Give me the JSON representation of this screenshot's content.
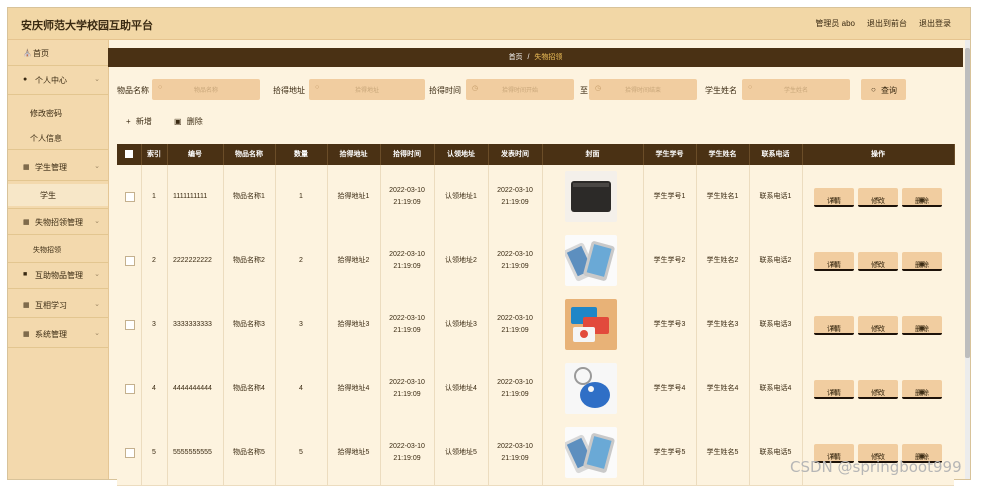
{
  "app": {
    "title": "安庆师范大学校园互助平台"
  },
  "topbar": {
    "user_label": "管理员 abo",
    "back_to_front": "退出到前台",
    "logout": "退出登录"
  },
  "sidebar": {
    "home": "首页",
    "personal_center": "个人中心",
    "change_password": "修改密码",
    "personal_info": "个人信息",
    "student_mgmt": "学生管理",
    "student": "学生",
    "lost_found_mgmt": "失物招领管理",
    "lost_found": "失物招领",
    "mutual_goods_mgmt": "互助物品管理",
    "mutual_learning": "互相学习",
    "system_mgmt": "系统管理"
  },
  "breadcrumb": {
    "home": "首页",
    "sep": "/",
    "current": "失物招领"
  },
  "search": {
    "item_name_label": "物品名称",
    "item_name_placeholder": "物品名称",
    "pickup_place_label": "拾得地址",
    "pickup_place_placeholder": "拾得地址",
    "pickup_time_label": "拾得时间",
    "pickup_time_start_placeholder": "拾得时间开始",
    "to_label": "至",
    "pickup_time_end_placeholder": "拾得时间结束",
    "student_name_label": "学生姓名",
    "student_name_placeholder": "学生姓名",
    "search_button": "查询"
  },
  "actions": {
    "add": "新增",
    "delete": "删除"
  },
  "table": {
    "headers": [
      "索引",
      "编号",
      "物品名称",
      "数量",
      "拾得地址",
      "拾得时间",
      "认领地址",
      "发表时间",
      "封面",
      "学生学号",
      "学生姓名",
      "联系电话",
      "操作"
    ],
    "op_labels": {
      "detail": "详情",
      "edit": "修改",
      "delete": "删除"
    },
    "rows": [
      {
        "index": "1",
        "code": "1111111111",
        "name": "物品名称1",
        "qty": "1",
        "pickup_place": "拾得地址1",
        "pickup_date": "2022-03-10",
        "pickup_time": "21:19:09",
        "claim_place": "认领地址1",
        "post_date": "2022-03-10",
        "post_time": "21:19:09",
        "cover": "wallet",
        "student_no": "学生学号1",
        "student_name": "学生姓名1",
        "phone": "联系电话1"
      },
      {
        "index": "2",
        "code": "2222222222",
        "name": "物品名称2",
        "qty": "2",
        "pickup_place": "拾得地址2",
        "pickup_date": "2022-03-10",
        "pickup_time": "21:19:09",
        "claim_place": "认领地址2",
        "post_date": "2022-03-10",
        "post_time": "21:19:09",
        "cover": "phone",
        "student_no": "学生学号2",
        "student_name": "学生姓名2",
        "phone": "联系电话2"
      },
      {
        "index": "3",
        "code": "3333333333",
        "name": "物品名称3",
        "qty": "3",
        "pickup_place": "拾得地址3",
        "pickup_date": "2022-03-10",
        "pickup_time": "21:19:09",
        "claim_place": "认领地址3",
        "post_date": "2022-03-10",
        "post_time": "21:19:09",
        "cover": "cards",
        "student_no": "学生学号3",
        "student_name": "学生姓名3",
        "phone": "联系电话3"
      },
      {
        "index": "4",
        "code": "4444444444",
        "name": "物品名称4",
        "qty": "4",
        "pickup_place": "拾得地址4",
        "pickup_date": "2022-03-10",
        "pickup_time": "21:19:09",
        "claim_place": "认领地址4",
        "post_date": "2022-03-10",
        "post_time": "21:19:09",
        "cover": "keyfob",
        "student_no": "学生学号4",
        "student_name": "学生姓名4",
        "phone": "联系电话4"
      },
      {
        "index": "5",
        "code": "5555555555",
        "name": "物品名称5",
        "qty": "5",
        "pickup_place": "拾得地址5",
        "pickup_date": "2022-03-10",
        "pickup_time": "21:19:09",
        "claim_place": "认领地址5",
        "post_date": "2022-03-10",
        "post_time": "21:19:09",
        "cover": "phone",
        "student_no": "学生学号5",
        "student_name": "学生姓名5",
        "phone": "联系电话5"
      }
    ]
  },
  "watermark": "CSDN @springboot999",
  "colors": {
    "header_bg": "#f2d7a6",
    "sidebar_bg": "#f3d9ad",
    "dark_brown": "#4a3114",
    "accent": "#f3c35a",
    "input_bg": "#f1cda0"
  }
}
